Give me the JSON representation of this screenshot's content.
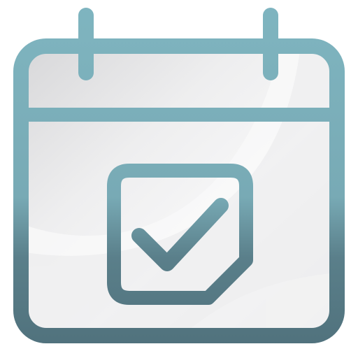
{
  "icon": {
    "name": "calendar-check-icon",
    "colors": {
      "stroke_top": "#7fb5c0",
      "stroke_mid": "#78aab5",
      "stroke_bottom": "#4f707b",
      "panel_light": "#f4f4f5",
      "panel_shade": "#d9d9db"
    }
  }
}
